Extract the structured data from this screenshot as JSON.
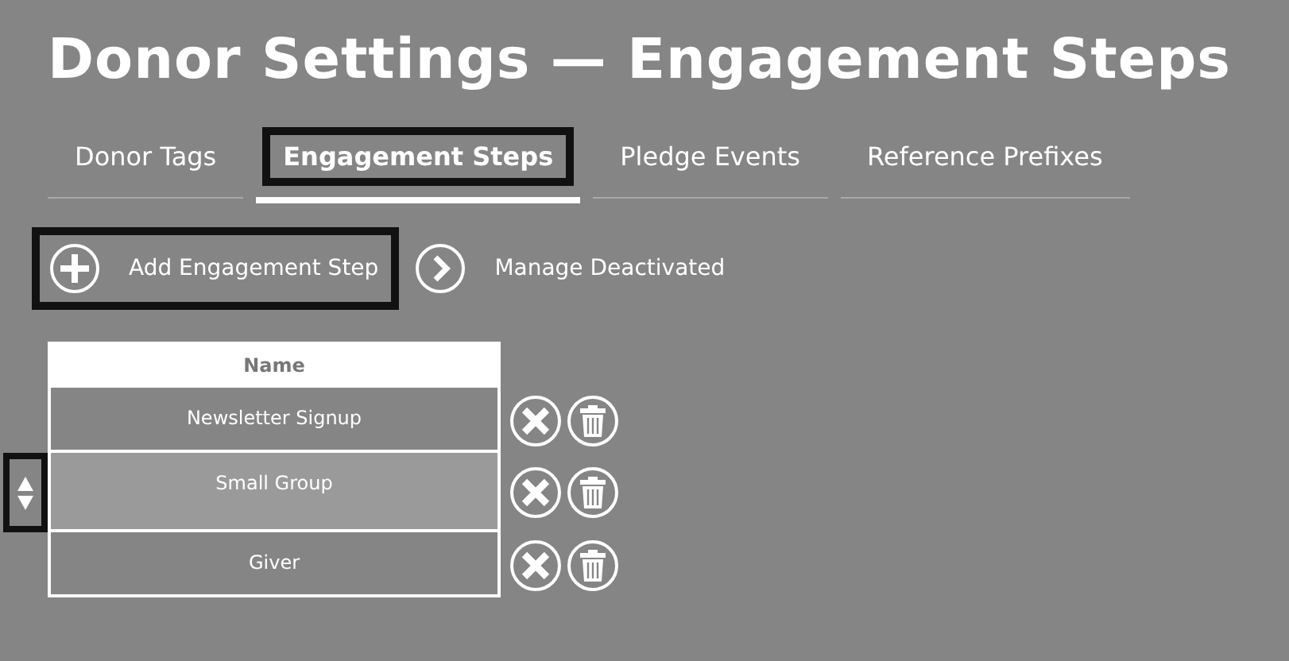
{
  "title": "Donor Settings — Engagement Steps",
  "tabs": [
    {
      "label": "Donor Tags",
      "selected": false
    },
    {
      "label": "Engagement Steps",
      "selected": true
    },
    {
      "label": "Pledge Events",
      "selected": false
    },
    {
      "label": "Reference Prefixes",
      "selected": false
    }
  ],
  "actions": {
    "add": "Add Engagement Step",
    "manage": "Manage Deactivated"
  },
  "table": {
    "columns": [
      "Name"
    ],
    "rows": [
      {
        "name": "Newsletter Signup",
        "selected": false
      },
      {
        "name": "Small Group",
        "selected": true
      },
      {
        "name": "Giver",
        "selected": false
      }
    ]
  }
}
